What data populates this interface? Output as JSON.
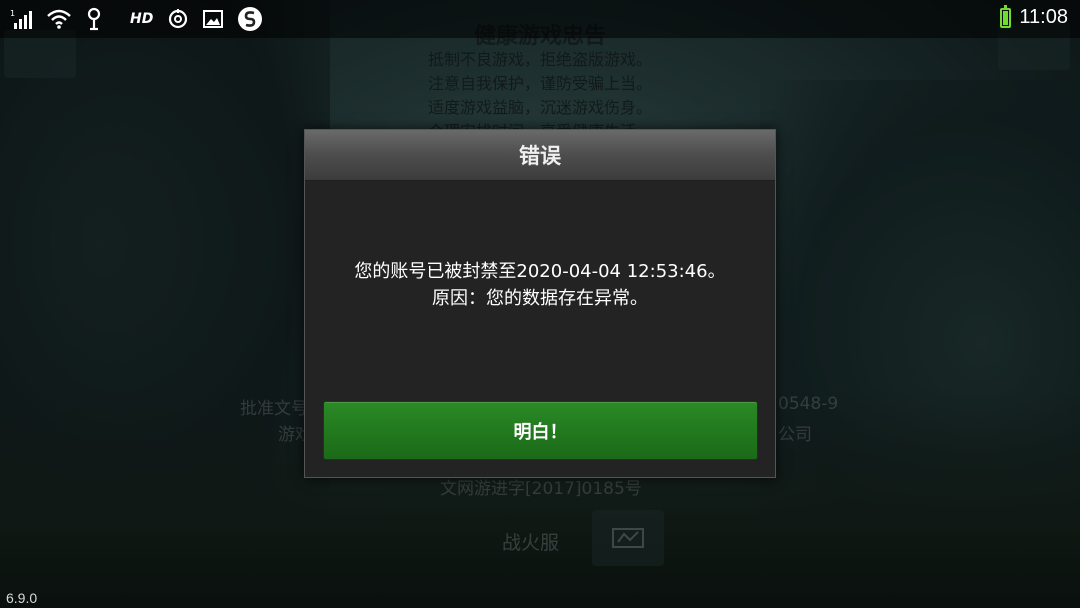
{
  "status_bar": {
    "signal_badge": "1",
    "hd_label": "HD",
    "time": "11:08",
    "icons": [
      "signal-icon",
      "wifi-icon",
      "location-icon",
      "hd-icon",
      "sync-icon",
      "gallery-icon",
      "s-app-icon",
      "battery-icon"
    ],
    "battery_color": "#6fdc2f"
  },
  "background": {
    "notice_title": "健康游戏忠告",
    "notice_lines": [
      "抵制不良游戏，拒绝盗版游戏。",
      "注意自我保护，谨防受骗上当。",
      "适度游戏益脑，沉迷游戏伤身。",
      "合理安排时间，享受健康生活。"
    ],
    "approval_left": "批准文号",
    "approval_right": "0548-9",
    "publisher_left": "游戏",
    "publisher_right": "公司",
    "license": "文网游进字[2017]0185号",
    "server_name": "战火服"
  },
  "dialog": {
    "title": "错误",
    "message_line1": "您的账号已被封禁至2020-04-04 12:53:46。",
    "message_line2": "原因：您的数据存在异常。",
    "ok_label": "明白！",
    "button_color": "#227a1e"
  },
  "version": "6.9.0"
}
